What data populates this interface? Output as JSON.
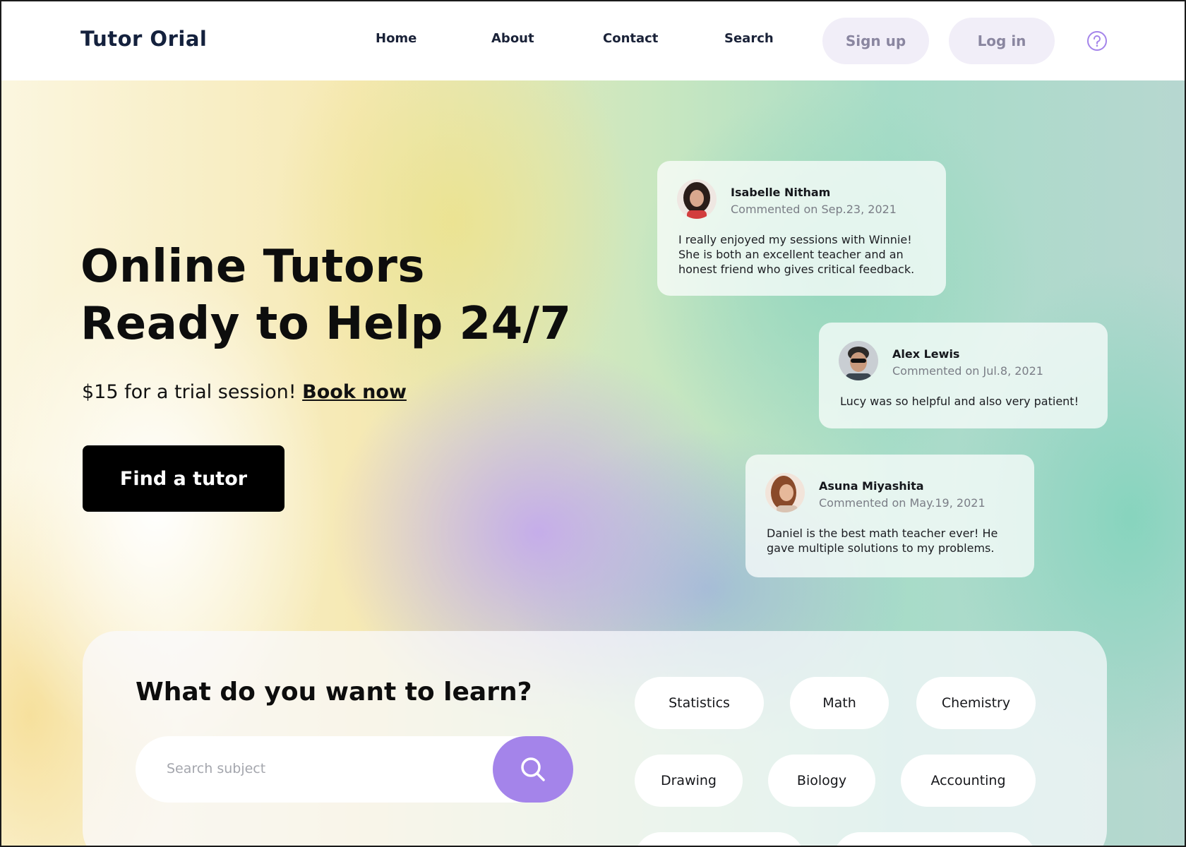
{
  "header": {
    "logo": "Tutor Orial",
    "nav": [
      "Home",
      "About",
      "Contact",
      "Search"
    ],
    "signup_label": "Sign up",
    "login_label": "Log in",
    "help_icon": "help-circle-icon"
  },
  "hero": {
    "title_line1": "Online Tutors",
    "title_line2": "Ready to Help 24/7",
    "trial_text": "$15 for a trial session!",
    "book_link": "Book now",
    "cta_label": "Find a tutor"
  },
  "comments": [
    {
      "name": "Isabelle Nitham",
      "date": "Commented on Sep.23, 2021",
      "text": "I really enjoyed my sessions with Winnie! She is both an excellent teacher and an honest friend who gives critical feedback."
    },
    {
      "name": "Alex Lewis",
      "date": "Commented on Jul.8, 2021",
      "text": "Lucy was so helpful and also very patient!"
    },
    {
      "name": "Asuna Miyashita",
      "date": "Commented on May.19, 2021",
      "text": "Daniel is the best math teacher ever! He gave multiple solutions to my problems."
    }
  ],
  "learn": {
    "title": "What do you want to learn?",
    "search_placeholder": "Search subject",
    "subjects": [
      "Statistics",
      "Math",
      "Chemistry",
      "Drawing",
      "Biology",
      "Accounting",
      "",
      ""
    ]
  },
  "colors": {
    "accent": "#a484ea",
    "pill_bg": "#f1eef8",
    "brand_text": "#14213d"
  }
}
